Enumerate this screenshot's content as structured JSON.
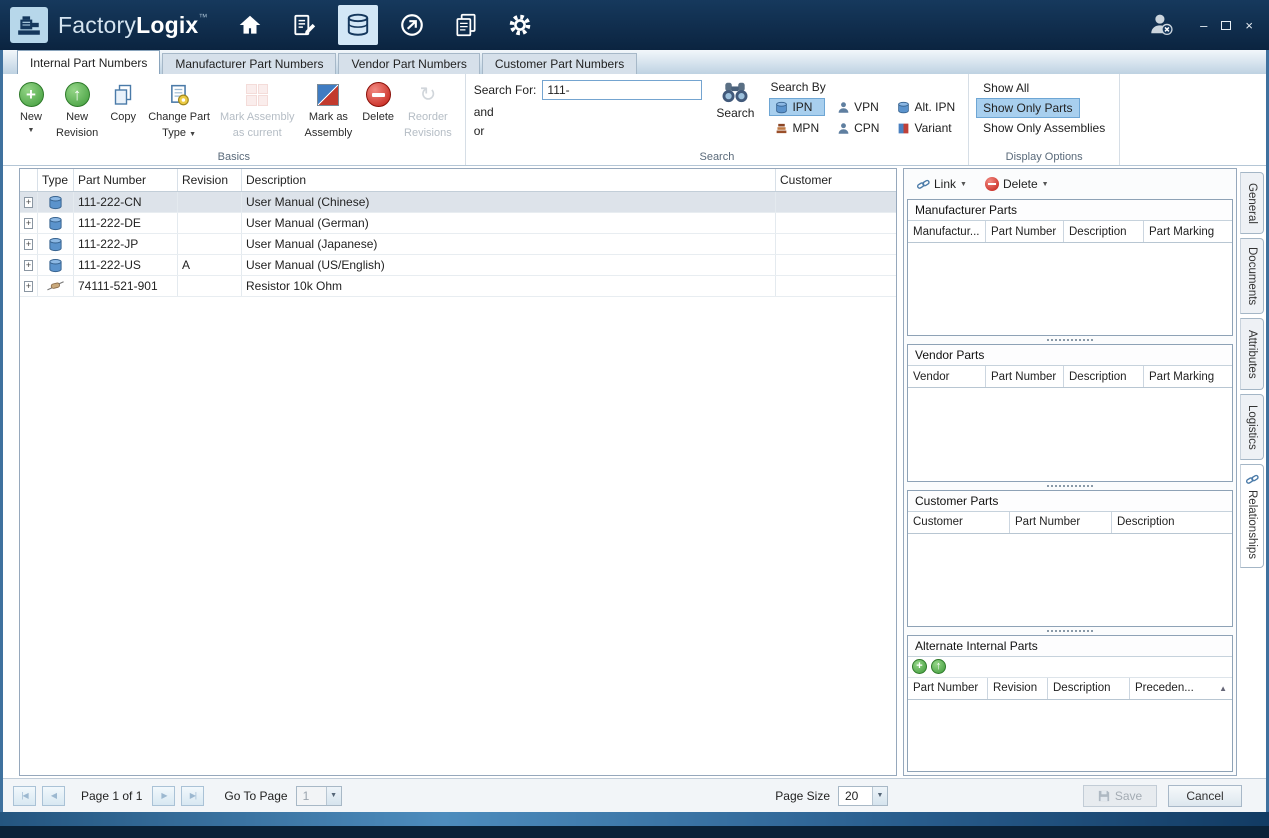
{
  "app": {
    "name_light": "Factory",
    "name_bold": "Logix",
    "trademark": "™"
  },
  "window_controls": {
    "minimize": "–",
    "close": "×"
  },
  "tabs": [
    {
      "label": "Internal Part Numbers"
    },
    {
      "label": "Manufacturer Part Numbers"
    },
    {
      "label": "Vendor Part Numbers"
    },
    {
      "label": "Customer Part Numbers"
    }
  ],
  "ribbon": {
    "groups": {
      "basics": "Basics",
      "search": "Search",
      "display": "Display Options"
    },
    "buttons": {
      "new": "New",
      "new_revision_1": "New",
      "new_revision_2": "Revision",
      "copy": "Copy",
      "change_type_1": "Change Part",
      "change_type_2": "Type",
      "mark_current_1": "Mark Assembly",
      "mark_current_2": "as current",
      "mark_assembly_1": "Mark as",
      "mark_assembly_2": "Assembly",
      "delete": "Delete",
      "reorder_1": "Reorder",
      "reorder_2": "Revisions",
      "search": "Search"
    },
    "search": {
      "search_for": "Search For:",
      "value": "111-",
      "and": "and",
      "or": "or",
      "search_by": "Search By",
      "options": [
        {
          "label": "IPN"
        },
        {
          "label": "VPN"
        },
        {
          "label": "Alt. IPN"
        },
        {
          "label": "MPN"
        },
        {
          "label": "CPN"
        },
        {
          "label": "Variant"
        }
      ]
    },
    "display": {
      "options": [
        {
          "label": "Show All"
        },
        {
          "label": "Show Only Parts"
        },
        {
          "label": "Show Only Assemblies"
        }
      ]
    }
  },
  "parts_table": {
    "columns": {
      "type": "Type",
      "part_number": "Part Number",
      "revision": "Revision",
      "description": "Description",
      "customer": "Customer"
    },
    "rows": [
      {
        "part_number": "111-222-CN",
        "revision": "",
        "description": "User Manual (Chinese)",
        "customer": ""
      },
      {
        "part_number": "111-222-DE",
        "revision": "",
        "description": "User Manual (German)",
        "customer": ""
      },
      {
        "part_number": "111-222-JP",
        "revision": "",
        "description": "User Manual (Japanese)",
        "customer": ""
      },
      {
        "part_number": "111-222-US",
        "revision": "A",
        "description": "User Manual (US/English)",
        "customer": ""
      },
      {
        "part_number": "74111-521-901",
        "revision": "",
        "description": "Resistor 10k Ohm",
        "customer": ""
      }
    ]
  },
  "relationships": {
    "link_button": "Link",
    "delete_button": "Delete",
    "manufacturer": {
      "title": "Manufacturer Parts",
      "columns": [
        "Manufactur...",
        "Part Number",
        "Description",
        "Part Marking"
      ]
    },
    "vendor": {
      "title": "Vendor Parts",
      "columns": [
        "Vendor",
        "Part Number",
        "Description",
        "Part Marking"
      ]
    },
    "customer": {
      "title": "Customer Parts",
      "columns": [
        "Customer",
        "Part Number",
        "Description"
      ]
    },
    "alternate": {
      "title": "Alternate Internal Parts",
      "columns": [
        "Part Number",
        "Revision",
        "Description",
        "Preceden..."
      ]
    }
  },
  "side_tabs": [
    {
      "label": "General"
    },
    {
      "label": "Documents"
    },
    {
      "label": "Attributes"
    },
    {
      "label": "Logistics"
    },
    {
      "label": "Relationships"
    }
  ],
  "statusbar": {
    "page_info": "Page 1 of 1",
    "goto_label": "Go To Page",
    "goto_value": "1",
    "page_size_label": "Page Size",
    "page_size_value": "20",
    "save": "Save",
    "cancel": "Cancel"
  }
}
